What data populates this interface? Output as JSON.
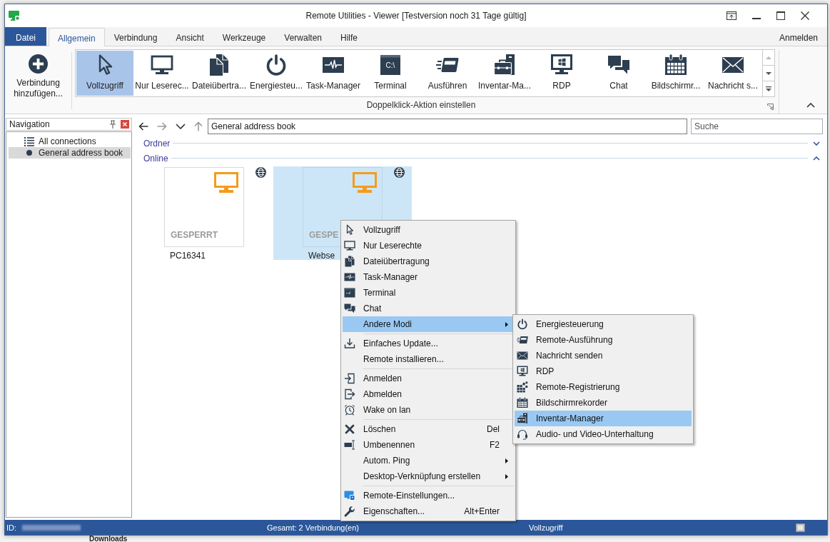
{
  "window": {
    "title": "Remote Utilities - Viewer [Testversion noch 31 Tage gültig]"
  },
  "ribbon_tabs": [
    {
      "label": "Datei",
      "kind": "file",
      "selected": false
    },
    {
      "label": "Allgemein",
      "kind": "tab",
      "selected": true
    },
    {
      "label": "Verbindung",
      "kind": "tab",
      "selected": false
    },
    {
      "label": "Ansicht",
      "kind": "tab",
      "selected": false
    },
    {
      "label": "Werkzeuge",
      "kind": "tab",
      "selected": false
    },
    {
      "label": "Verwalten",
      "kind": "tab",
      "selected": false
    },
    {
      "label": "Hilfe",
      "kind": "tab",
      "selected": false
    }
  ],
  "account": {
    "label": "Anmelden"
  },
  "ribbon": {
    "add_button": {
      "label": "Verbindung hinzufügen..."
    },
    "gallery": [
      {
        "label": "Vollzugriff",
        "selected": true
      },
      {
        "label": "Nur Leserec...",
        "selected": false
      },
      {
        "label": "Dateiübertra...",
        "selected": false
      },
      {
        "label": "Energiesteu...",
        "selected": false
      },
      {
        "label": "Task-Manager",
        "selected": false
      },
      {
        "label": "Terminal",
        "selected": false,
        "icon_text": "C:\\"
      },
      {
        "label": "Ausführen",
        "selected": false
      },
      {
        "label": "Inventar-Ma...",
        "selected": false
      },
      {
        "label": "RDP",
        "selected": false
      },
      {
        "label": "Chat",
        "selected": false
      },
      {
        "label": "Bildschirmr...",
        "selected": false
      },
      {
        "label": "Nachricht s...",
        "selected": false
      }
    ],
    "gallery_scroll": [
      {
        "disabled": true
      },
      {
        "disabled": false
      },
      {
        "disabled": false
      }
    ],
    "group_label": "Doppelklick-Aktion einstellen"
  },
  "navigation": {
    "title": "Navigation",
    "items": [
      {
        "label": "All connections",
        "selected": false
      },
      {
        "label": "General address book",
        "selected": true
      }
    ]
  },
  "history_buttons": [
    {
      "disabled": false
    },
    {
      "disabled": true
    },
    {
      "disabled": false
    },
    {
      "disabled": true
    }
  ],
  "address_bar": {
    "value": "General address book"
  },
  "search": {
    "placeholder": "Suche"
  },
  "sections": [
    {
      "label": "Ordner",
      "expanded": false
    },
    {
      "label": "Online",
      "expanded": true
    }
  ],
  "connections": [
    {
      "name": "PC16341",
      "status": "GESPERRT",
      "selected": false
    },
    {
      "name": "Webse",
      "status": "GESPE",
      "selected": true
    }
  ],
  "context_menu": [
    {
      "kind": "item",
      "label": "Vollzugriff",
      "selected": false
    },
    {
      "kind": "item",
      "label": "Nur Leserechte",
      "selected": false
    },
    {
      "kind": "item",
      "label": "Dateiübertragung",
      "selected": false
    },
    {
      "kind": "item",
      "label": "Task-Manager",
      "selected": false
    },
    {
      "kind": "item",
      "label": "Terminal",
      "selected": false
    },
    {
      "kind": "item",
      "label": "Chat",
      "selected": false
    },
    {
      "kind": "submenu",
      "label": "Andere Modi",
      "selected": true,
      "items": [
        {
          "label": "Energiesteuerung",
          "selected": false
        },
        {
          "label": "Remote-Ausführung",
          "selected": false
        },
        {
          "label": "Nachricht senden",
          "selected": false
        },
        {
          "label": "RDP",
          "selected": false
        },
        {
          "label": "Remote-Registrierung",
          "selected": false
        },
        {
          "label": "Bildschirmrekorder",
          "selected": false
        },
        {
          "label": "Inventar-Manager",
          "selected": true
        },
        {
          "label": "Audio- und Video-Unterhaltung",
          "selected": false
        }
      ]
    },
    {
      "kind": "separator"
    },
    {
      "kind": "item",
      "label": "Einfaches Update...",
      "selected": false
    },
    {
      "kind": "item",
      "label": "Remote installieren...",
      "selected": false
    },
    {
      "kind": "separator"
    },
    {
      "kind": "item",
      "label": "Anmelden",
      "selected": false
    },
    {
      "kind": "item",
      "label": "Abmelden",
      "selected": false
    },
    {
      "kind": "item",
      "label": "Wake on lan",
      "selected": false
    },
    {
      "kind": "separator"
    },
    {
      "kind": "item",
      "label": "Löschen",
      "shortcut": "Del",
      "selected": false
    },
    {
      "kind": "item",
      "label": "Umbenennen",
      "shortcut": "F2",
      "selected": false
    },
    {
      "kind": "submenu",
      "label": "Autom. Ping",
      "selected": false
    },
    {
      "kind": "submenu",
      "label": "Desktop-Verknüpfung erstellen",
      "selected": false
    },
    {
      "kind": "separator"
    },
    {
      "kind": "item",
      "label": "Remote-Einstellungen...",
      "selected": false
    },
    {
      "kind": "item",
      "label": "Eigenschaften...",
      "shortcut": "Alt+Enter",
      "selected": false
    }
  ],
  "status_bar": {
    "id_label": "ID:",
    "total": "Gesamt: 2 Verbindung(en)",
    "mode": "Vollzugriff"
  },
  "background_page": {
    "heading": "Downloads"
  }
}
